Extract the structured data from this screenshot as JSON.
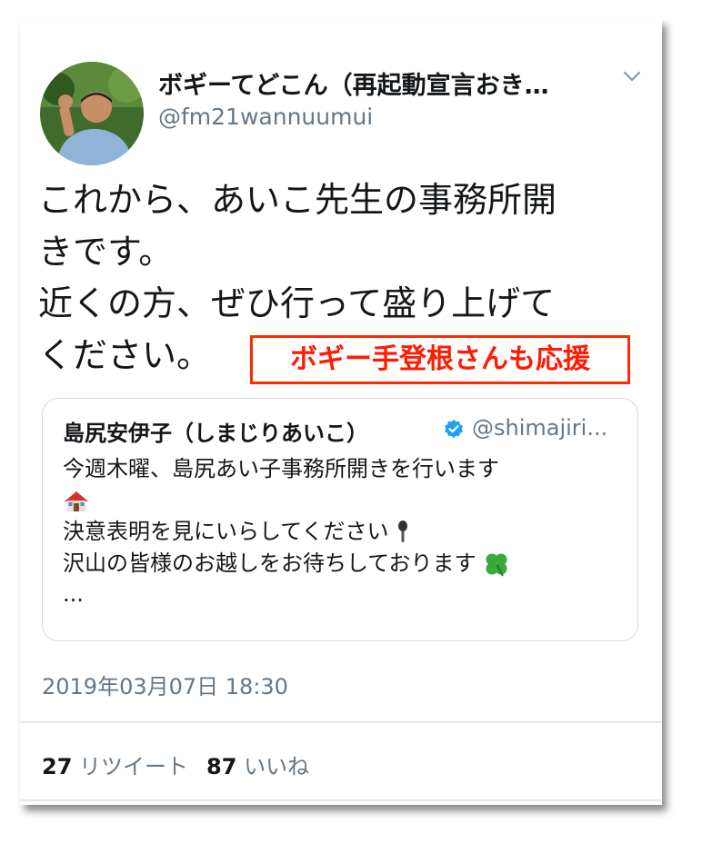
{
  "tweet": {
    "display_name": "ボギーてどこん（再起動宣言おき…",
    "handle": "@fm21wannuumui",
    "text_lines": [
      "これから、あいこ先生の事務所開",
      "きです。",
      "近くの方、ぜひ行って盛り上げて",
      "ください。"
    ],
    "menu_icon": "chevron-down-icon",
    "avatar_icon": "avatar-photo"
  },
  "overlay": {
    "label": "ボギー手登根さんも応援",
    "color": "#ff1a00"
  },
  "quoted_tweet": {
    "display_name": "島尻安伊子（しまじりあいこ）",
    "verified_icon": "verified-badge-icon",
    "handle": "@shimajiri...",
    "lines": [
      "今週木曜、島尻あい子事務所開きを行います",
      "",
      "決意表明を見にいらしてください",
      "沢山の皆様のお越しをお待ちしております",
      "..."
    ],
    "emoji": [
      "house-icon",
      "microphone-icon",
      "four-leaf-clover-icon"
    ]
  },
  "timestamp": "2019年03月07日 18:30",
  "stats": {
    "retweet_count": "27",
    "retweet_label": "リツイート",
    "like_count": "87",
    "like_label": "いいね"
  },
  "colors": {
    "text": "#14171a",
    "secondary": "#657786",
    "verified": "#1da1f2",
    "border": "#e1e8ed",
    "accent_red": "#ff2a00"
  }
}
